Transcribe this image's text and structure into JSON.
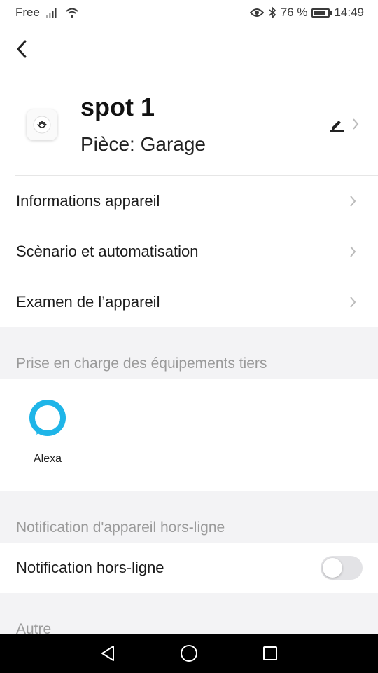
{
  "status_bar": {
    "carrier": "Free",
    "battery": "76 %",
    "time": "14:49",
    "icons": [
      "signal-icon",
      "wifi-icon",
      "eye-icon",
      "bluetooth-icon",
      "battery-icon"
    ]
  },
  "device": {
    "name": "spot 1",
    "room": "Pièce: Garage",
    "icon": "smart-plug-icon"
  },
  "menu": {
    "items": [
      {
        "label": "Informations appareil"
      },
      {
        "label": "Scènario et automatisation"
      },
      {
        "label": "Examen de l’appareil"
      }
    ]
  },
  "third_party": {
    "title": "Prise en charge des équipements tiers",
    "services": [
      {
        "label": "Alexa",
        "icon": "alexa-icon",
        "color": "#1fb5e8"
      }
    ]
  },
  "offline": {
    "title": "Notification d'appareil hors-ligne",
    "toggle_label": "Notification hors-ligne",
    "enabled": false
  },
  "other": {
    "title": "Autre"
  },
  "nav_bar": {
    "icons": [
      "back-triangle-icon",
      "home-circle-icon",
      "recent-square-icon"
    ]
  }
}
